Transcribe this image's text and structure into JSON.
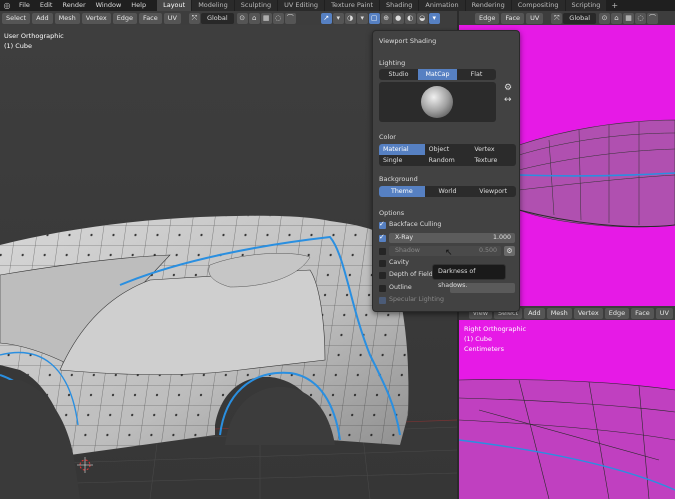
{
  "topbar": {
    "menus": [
      "File",
      "Edit",
      "Render",
      "Window",
      "Help"
    ],
    "workspaces": [
      "Layout",
      "Modeling",
      "Sculpting",
      "UV Editing",
      "Texture Paint",
      "Shading",
      "Animation",
      "Rendering",
      "Compositing",
      "Scripting"
    ],
    "active_workspace": "Layout",
    "add_tab": "+"
  },
  "left_header": {
    "buttons": [
      "Select",
      "Add",
      "Mesh",
      "Vertex",
      "Edge",
      "Face",
      "UV"
    ],
    "orientation": "Global"
  },
  "right_header": {
    "edit_buttons": [
      "Edge",
      "Face",
      "UV"
    ],
    "orientation": "Global"
  },
  "right_bottom_header": {
    "buttons": [
      "View",
      "Select",
      "Add",
      "Mesh",
      "Vertex",
      "Edge",
      "Face",
      "UV"
    ]
  },
  "viewport_left": {
    "view_name": "User Orthographic",
    "object_name": "(1) Cube"
  },
  "viewport_right_bottom": {
    "view_name": "Right Orthographic",
    "object_name": "(1) Cube",
    "units": "Centimeters"
  },
  "popover": {
    "title": "Viewport Shading",
    "lighting": {
      "label": "Lighting",
      "options": [
        "Studio",
        "MatCap",
        "Flat"
      ],
      "selected": "MatCap"
    },
    "color": {
      "label": "Color",
      "options": [
        "Material",
        "Object",
        "Vertex",
        "Single",
        "Random",
        "Texture"
      ],
      "selected": "Material"
    },
    "background": {
      "label": "Background",
      "options": [
        "Theme",
        "World",
        "Viewport"
      ],
      "selected": "Theme"
    },
    "options": {
      "label": "Options",
      "backface_culling": "Backface Culling",
      "xray": "X-Ray",
      "xray_value": "1.000",
      "shadow": "Shadow",
      "shadow_value": "0.500",
      "cavity": "Cavity",
      "depth_of_field": "Depth of Field",
      "outline": "Outline",
      "specular": "Specular Lighting"
    }
  },
  "tooltip": "Darkness of shadows.",
  "colors": {
    "accent": "#5680c2",
    "magenta_bg": "#e61ae6",
    "mesh_edge_blue": "#2a8fe0"
  }
}
